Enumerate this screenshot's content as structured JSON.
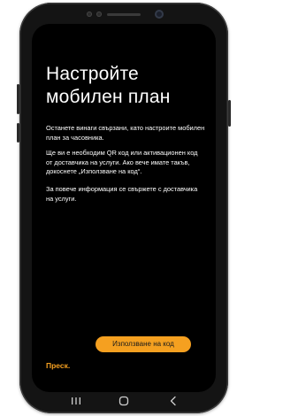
{
  "screen": {
    "title": "Настройте мобилен план",
    "paragraphs": [
      "Останете винаги свързани, като настроите мобилен план за часовника.",
      "Ще ви е необходим QR код или активационен код от доставчика на услуги. Ако вече имате такъв, докоснете „Използване на код“.",
      "За повече информация се свържете с доставчика на услуги."
    ],
    "primary_button_label": "Използване на код",
    "skip_label": "Преск."
  },
  "navigation": {
    "icons": [
      "recent-apps-icon",
      "home-icon",
      "back-icon"
    ]
  },
  "colors": {
    "accent": "#f5a020",
    "screen_background": "#000000",
    "device_body": "#141414"
  }
}
